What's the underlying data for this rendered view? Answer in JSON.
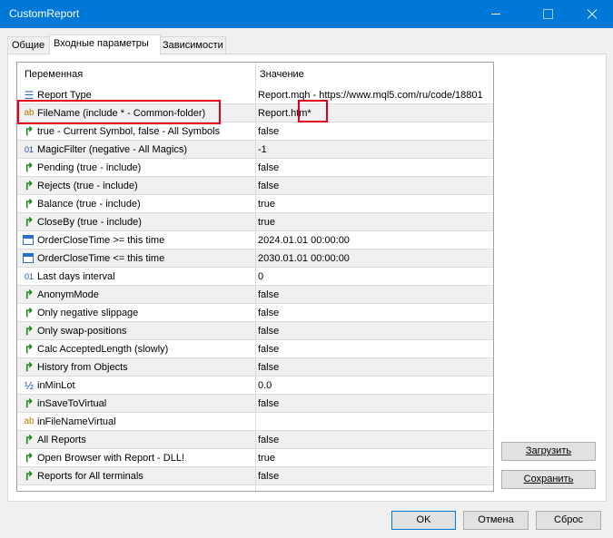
{
  "window": {
    "title": "CustomReport"
  },
  "tabs": [
    "Общие",
    "Входные параметры",
    "Зависимости"
  ],
  "grid": {
    "headers": {
      "variable": "Переменная",
      "value": "Значение"
    },
    "rows": [
      {
        "icon": "enum-icon",
        "name": "Report Type",
        "value": "Report.mqh - https://www.mql5.com/ru/code/18801"
      },
      {
        "icon": "string-icon",
        "name": "FileName (include * - Common-folder)",
        "value": "Report.htm*"
      },
      {
        "icon": "bool-icon",
        "name": "true - Current Symbol, false - All Symbols",
        "value": "false"
      },
      {
        "icon": "int-icon",
        "name": "MagicFilter (negative - All Magics)",
        "value": "-1"
      },
      {
        "icon": "bool-icon",
        "name": "Pending (true - include)",
        "value": "false"
      },
      {
        "icon": "bool-icon",
        "name": "Rejects (true - include)",
        "value": "false"
      },
      {
        "icon": "bool-icon",
        "name": "Balance (true - include)",
        "value": "true"
      },
      {
        "icon": "bool-icon",
        "name": "CloseBy (true - include)",
        "value": "true"
      },
      {
        "icon": "calendar-icon",
        "name": "OrderCloseTime >= this time",
        "value": "2024.01.01 00:00:00"
      },
      {
        "icon": "calendar-icon",
        "name": "OrderCloseTime <= this time",
        "value": "2030.01.01 00:00:00"
      },
      {
        "icon": "int-icon",
        "name": "Last days interval",
        "value": "0"
      },
      {
        "icon": "bool-icon",
        "name": "AnonymMode",
        "value": "false"
      },
      {
        "icon": "bool-icon",
        "name": "Only negative slippage",
        "value": "false"
      },
      {
        "icon": "bool-icon",
        "name": "Only swap-positions",
        "value": "false"
      },
      {
        "icon": "bool-icon",
        "name": "Calc AcceptedLength (slowly)",
        "value": "false"
      },
      {
        "icon": "bool-icon",
        "name": "History from Objects",
        "value": "false"
      },
      {
        "icon": "double-icon",
        "name": "inMinLot",
        "value": "0.0"
      },
      {
        "icon": "bool-icon",
        "name": "inSaveToVirtual",
        "value": "false"
      },
      {
        "icon": "string-icon",
        "name": "inFileNameVirtual",
        "value": ""
      },
      {
        "icon": "bool-icon",
        "name": "All Reports",
        "value": "false"
      },
      {
        "icon": "bool-icon",
        "name": "Open Browser with Report - DLL!",
        "value": "true"
      },
      {
        "icon": "bool-icon",
        "name": "Reports for All terminals",
        "value": "false"
      }
    ]
  },
  "buttons": {
    "load": "Загрузить",
    "save": "Сохранить",
    "ok": "OK",
    "cancel": "Отмена",
    "reset": "Сброс"
  },
  "colors": {
    "titlebar": "#0078d7",
    "highlight": "#e0001a"
  }
}
